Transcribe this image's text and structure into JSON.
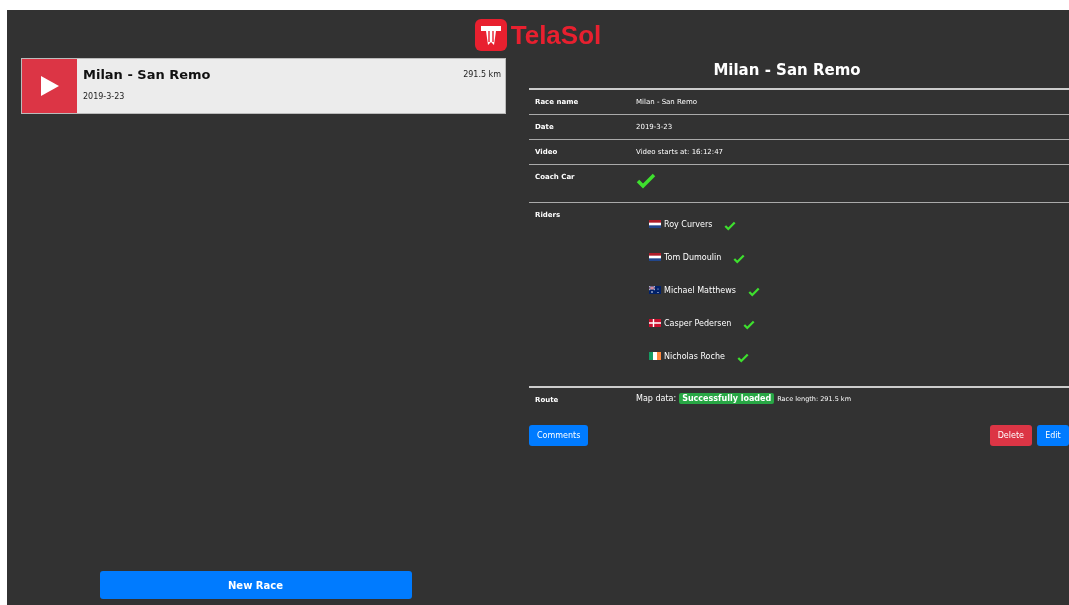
{
  "logo": {
    "text": "TelaSol"
  },
  "races": [
    {
      "name": "Milan - San Remo",
      "date": "2019-3-23",
      "distance": "291.5 km",
      "selected": true
    }
  ],
  "new_race_button": "New Race",
  "detail": {
    "title": "Milan - San Remo",
    "rows": [
      {
        "kind": "text",
        "label": "Race name",
        "value": "Milan - San Remo"
      },
      {
        "kind": "text",
        "label": "Date",
        "value": "2019-3-23"
      },
      {
        "kind": "text",
        "label": "Video",
        "value": "Video starts at: 16:12:47"
      },
      {
        "kind": "check",
        "label": "Coach Car",
        "checked": true
      }
    ],
    "riders_label": "Riders",
    "riders": [
      {
        "name": "Roy Curvers",
        "kind": "netherlands",
        "checked": true
      },
      {
        "name": "Tom Dumoulin",
        "kind": "netherlands",
        "checked": true
      },
      {
        "name": "Michael Matthews",
        "kind": "australia",
        "checked": true
      },
      {
        "name": "Casper Pedersen",
        "kind": "denmark",
        "checked": true
      },
      {
        "name": "Nicholas Roche",
        "kind": "ireland",
        "checked": true
      }
    ],
    "route": {
      "label": "Route",
      "map_label": "Map data:",
      "map_status": "Successfully loaded",
      "length": "Race length: 291.5 km"
    },
    "buttons": [
      {
        "label": "Comments",
        "kind": "primary"
      },
      {
        "label": "Delete",
        "kind": "danger"
      },
      {
        "label": "Edit",
        "kind": "primary"
      }
    ]
  }
}
